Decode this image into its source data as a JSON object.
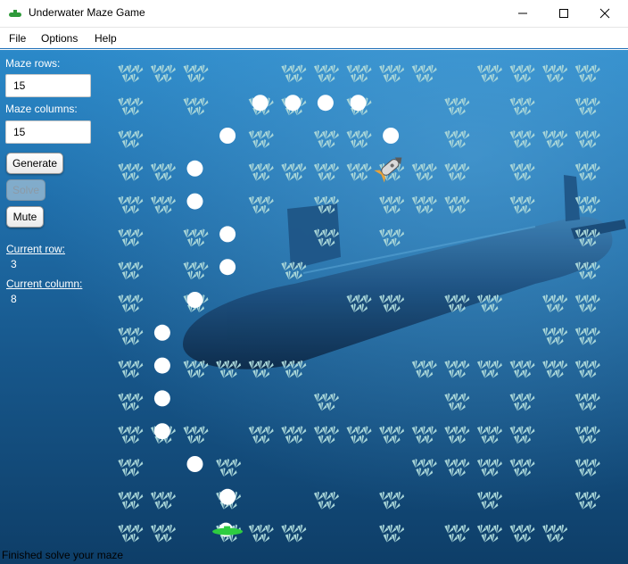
{
  "window": {
    "title": "Underwater Maze Game",
    "minimize_icon": "minimize-icon",
    "maximize_icon": "maximize-icon",
    "close_icon": "close-icon"
  },
  "menu": {
    "file": "File",
    "options": "Options",
    "help": "Help"
  },
  "panel": {
    "rows_label": "Maze rows:",
    "rows_value": "15",
    "cols_label": "Maze columns:",
    "cols_value": "15",
    "generate": "Generate",
    "solve": "Solve",
    "mute": "Mute",
    "current_row_label": "Current row:",
    "current_row_value": "3",
    "current_col_label": "Current column:",
    "current_col_value": "8"
  },
  "status": "Finished solve your maze",
  "maze": {
    "rows": 15,
    "cols": 15,
    "wall_map": [
      "###..#####.####",
      "#.#.##.#..#.#.#",
      "#...#.##..#.###",
      "##..#######.#.#",
      "##..#.#.###.#.#",
      "#.#...#.#.....#",
      "#.#..#........#",
      "#.#....##.##.##",
      "#............##",
      "#.####...######",
      "#.....#...#.#.#",
      "###.#########.#",
      "#..#.....####.#",
      "##.#..#.#..#..#",
      "##.###..#.####."
    ],
    "path_dots": [
      [
        1,
        4
      ],
      [
        1,
        5
      ],
      [
        1,
        6
      ],
      [
        1,
        7
      ],
      [
        2,
        3
      ],
      [
        2,
        8
      ],
      [
        3,
        2
      ],
      [
        4,
        2
      ],
      [
        5,
        3
      ],
      [
        6,
        3
      ],
      [
        7,
        2
      ],
      [
        8,
        1
      ],
      [
        9,
        1
      ],
      [
        10,
        1
      ],
      [
        11,
        1
      ],
      [
        12,
        2
      ],
      [
        13,
        3
      ]
    ],
    "rocket_cell": [
      3,
      8
    ],
    "player_cell": [
      14,
      3
    ]
  },
  "colors": {
    "water_top": "#2b89c9",
    "water_bottom": "#0e3e68",
    "weed": "#a9d6d8",
    "dot": "#ffffff",
    "player": "#2ecc40"
  }
}
